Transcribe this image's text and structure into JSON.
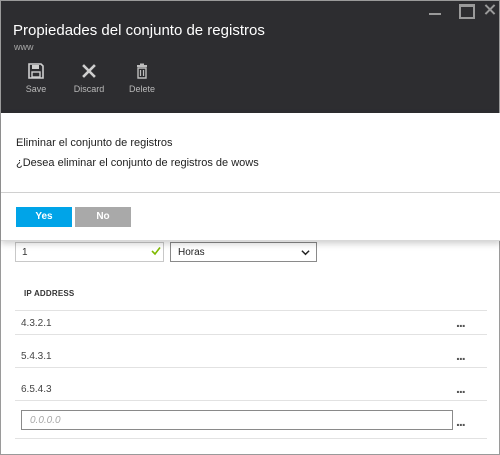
{
  "header": {
    "title": "Propiedades del conjunto de registros",
    "subtitle": "www"
  },
  "toolbar": {
    "save_label": "Save",
    "discard_label": "Discard",
    "delete_label": "Delete"
  },
  "dialog": {
    "title": "Eliminar el conjunto de registros",
    "message": "¿Desea eliminar el conjunto de registros de wows",
    "yes_label": "Yes",
    "no_label": "No"
  },
  "ttl": {
    "value": "1",
    "unit": "Horas"
  },
  "ip_table": {
    "header": "IP ADDRESS",
    "rows": [
      "4.3.2.1",
      "5.4.3.1",
      "6.5.4.3"
    ],
    "new_placeholder": "0.0.0.0",
    "more_glyph": "..."
  },
  "colors": {
    "header_bg": "#2d2d30",
    "accent": "#00a4e8",
    "no_button": "#a9a9a9",
    "valid_check": "#7fba00"
  }
}
